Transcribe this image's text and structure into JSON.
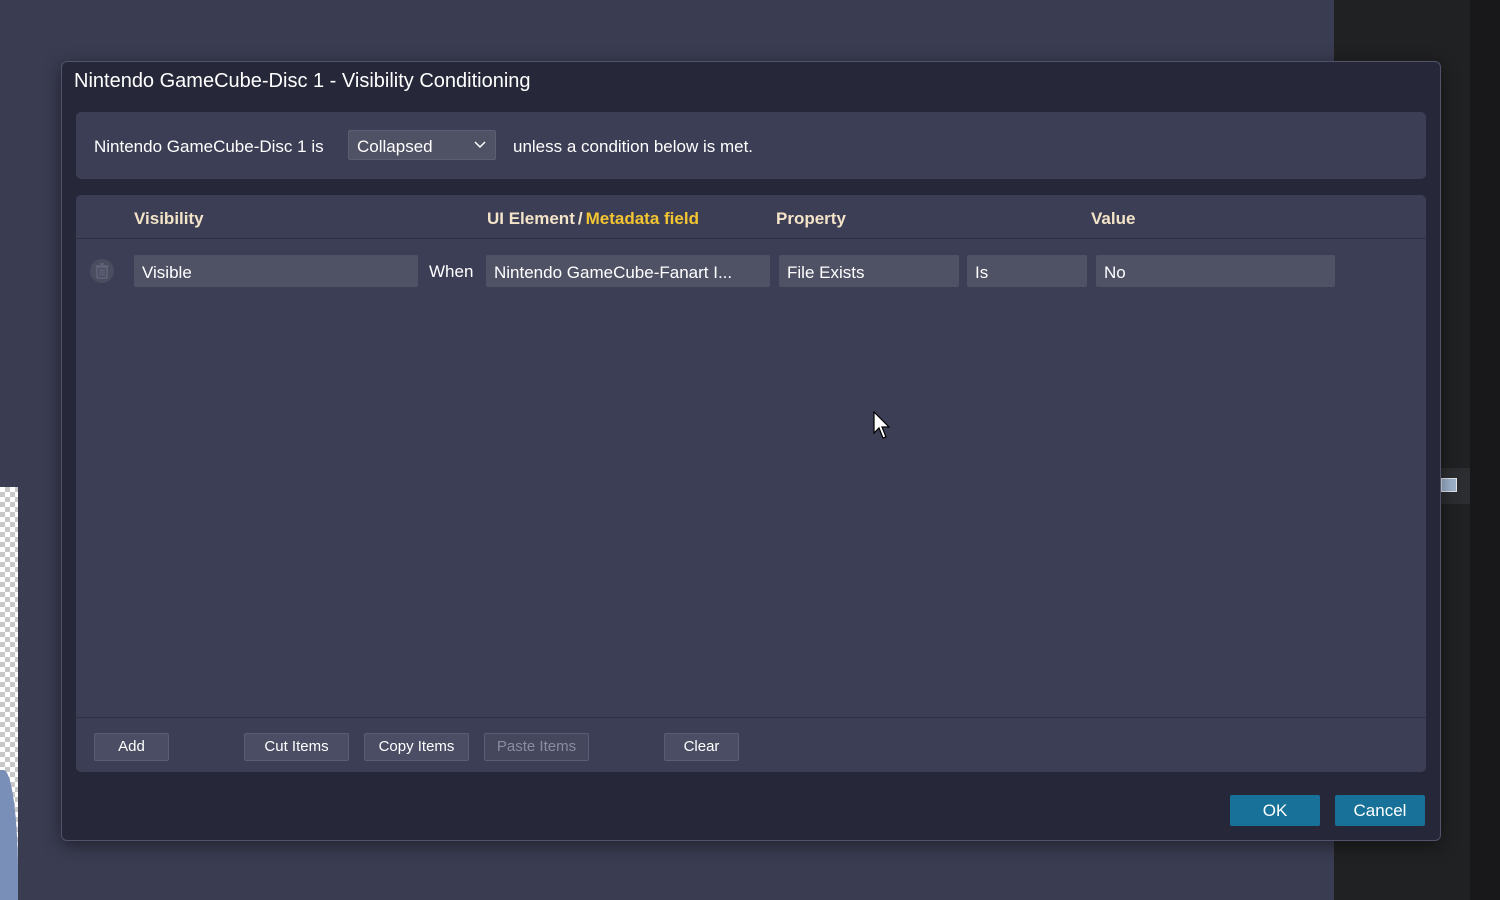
{
  "dialog": {
    "title": "Nintendo GameCube-Disc 1 - Visibility Conditioning"
  },
  "condition": {
    "prefix": "Nintendo GameCube-Disc 1 is",
    "state_value": "Collapsed",
    "suffix": "unless a condition below is met."
  },
  "grid": {
    "headers": {
      "visibility": "Visibility",
      "ui_element": "UI Element",
      "separator": "/",
      "metadata_field": "Metadata field",
      "property": "Property",
      "value": "Value"
    },
    "rows": [
      {
        "visibility": "Visible",
        "when": "When",
        "element": "Nintendo GameCube-Fanart I...",
        "property": "File Exists",
        "operator": "Is",
        "value": "No"
      }
    ]
  },
  "toolbar": {
    "add": "Add",
    "cut": "Cut Items",
    "copy": "Copy Items",
    "paste": "Paste Items",
    "clear": "Clear"
  },
  "buttons": {
    "ok": "OK",
    "cancel": "Cancel"
  },
  "colors": {
    "accent": "#177198",
    "metadata_field": "#f2c531",
    "header_text": "#f3e3c8"
  },
  "icons": {
    "delete": "trash-icon",
    "dropdown": "chevron-down-icon"
  }
}
